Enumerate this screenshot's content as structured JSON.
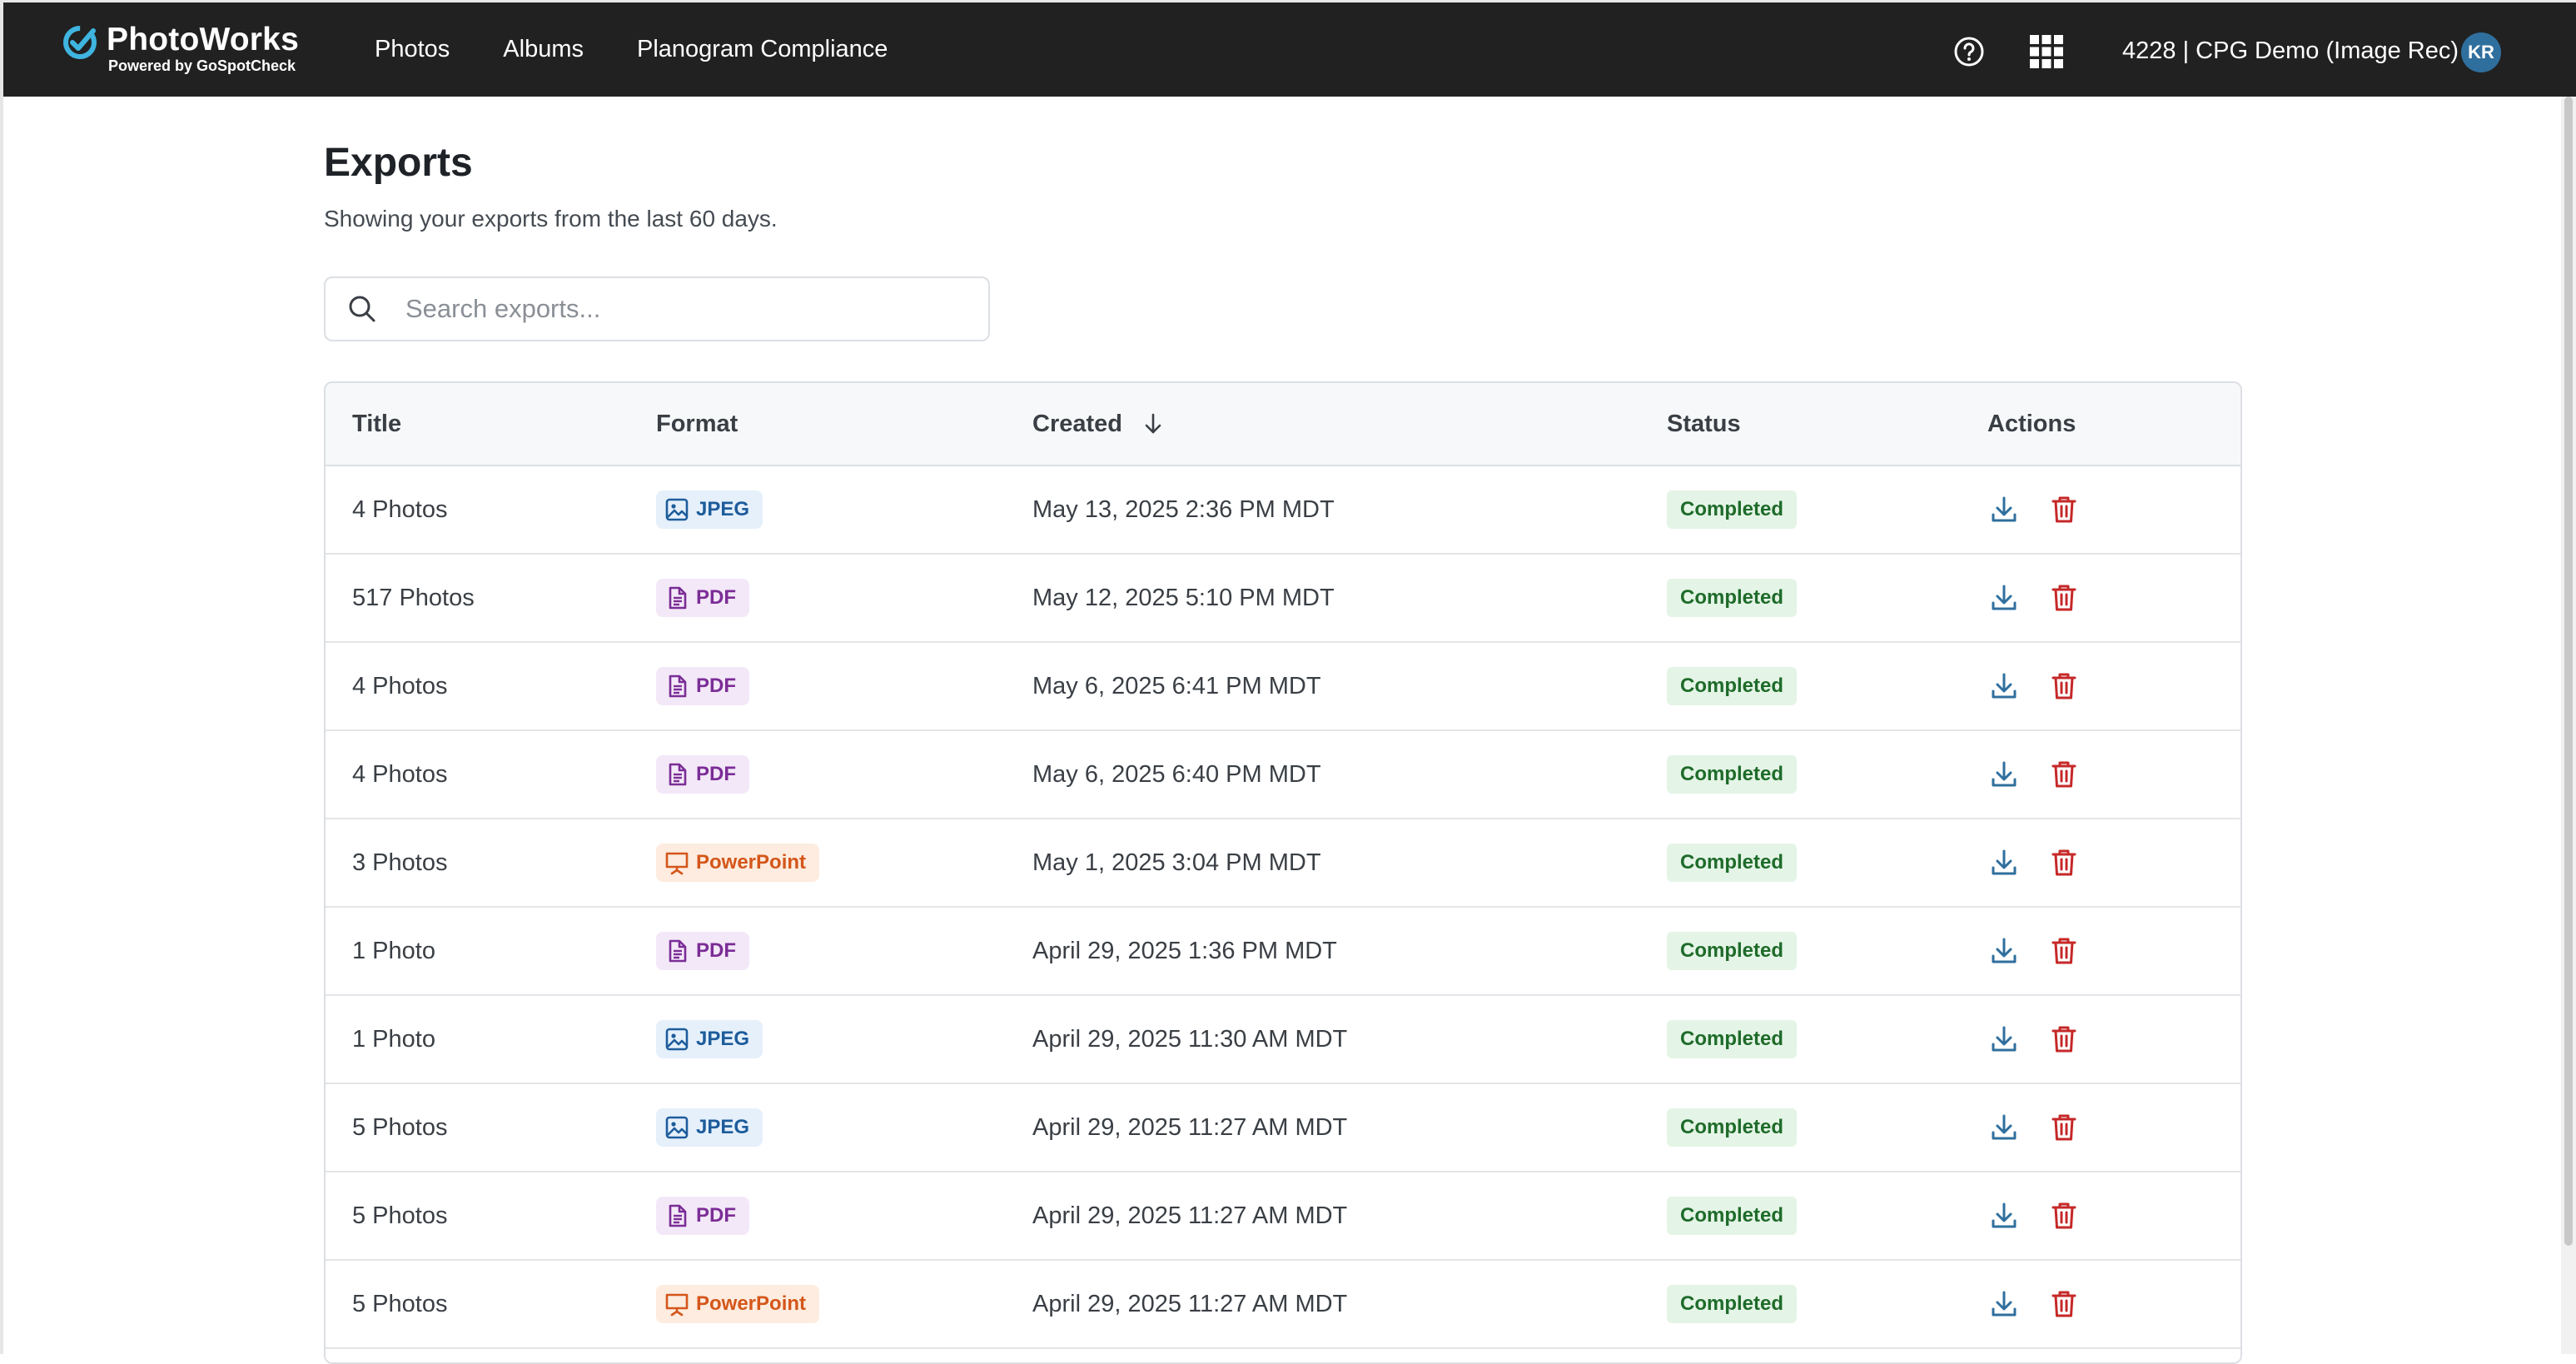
{
  "header": {
    "brand": "PhotoWorks",
    "brand_sub": "Powered by GoSpotCheck",
    "nav": [
      {
        "label": "Photos"
      },
      {
        "label": "Albums"
      },
      {
        "label": "Planogram Compliance"
      }
    ],
    "org": "4228 | CPG Demo (Image Rec)",
    "avatar_initials": "KR"
  },
  "page": {
    "title": "Exports",
    "subtitle": "Showing your exports from the last 60 days."
  },
  "search": {
    "placeholder": "Search exports...",
    "value": ""
  },
  "table": {
    "columns": {
      "title": "Title",
      "format": "Format",
      "created": "Created",
      "status": "Status",
      "actions": "Actions"
    },
    "sort": {
      "column": "Created",
      "direction": "descending"
    },
    "rows": [
      {
        "title": "4 Photos",
        "format": "JPEG",
        "created": "May 13, 2025 2:36 PM MDT",
        "status": "Completed"
      },
      {
        "title": "517 Photos",
        "format": "PDF",
        "created": "May 12, 2025 5:10 PM MDT",
        "status": "Completed"
      },
      {
        "title": "4 Photos",
        "format": "PDF",
        "created": "May 6, 2025 6:41 PM MDT",
        "status": "Completed"
      },
      {
        "title": "4 Photos",
        "format": "PDF",
        "created": "May 6, 2025 6:40 PM MDT",
        "status": "Completed"
      },
      {
        "title": "3 Photos",
        "format": "PowerPoint",
        "created": "May 1, 2025 3:04 PM MDT",
        "status": "Completed"
      },
      {
        "title": "1 Photo",
        "format": "PDF",
        "created": "April 29, 2025 1:36 PM MDT",
        "status": "Completed"
      },
      {
        "title": "1 Photo",
        "format": "JPEG",
        "created": "April 29, 2025 11:30 AM MDT",
        "status": "Completed"
      },
      {
        "title": "5 Photos",
        "format": "JPEG",
        "created": "April 29, 2025 11:27 AM MDT",
        "status": "Completed"
      },
      {
        "title": "5 Photos",
        "format": "PDF",
        "created": "April 29, 2025 11:27 AM MDT",
        "status": "Completed"
      },
      {
        "title": "5 Photos",
        "format": "PowerPoint",
        "created": "April 29, 2025 11:27 AM MDT",
        "status": "Completed"
      }
    ]
  },
  "colors": {
    "navbar": "#212121",
    "brand_accent": "#3fb5e0",
    "jpeg": "#1d5c9b",
    "pdf": "#7b2d96",
    "powerpoint": "#d4561a",
    "status_completed": "#1e6b2a",
    "download_icon": "#2f6f9e",
    "delete_icon": "#c62828"
  },
  "icons": {
    "jpeg": "image-icon",
    "pdf": "document-icon",
    "powerpoint": "presentation-icon",
    "download": "download-icon",
    "delete": "trash-icon"
  }
}
